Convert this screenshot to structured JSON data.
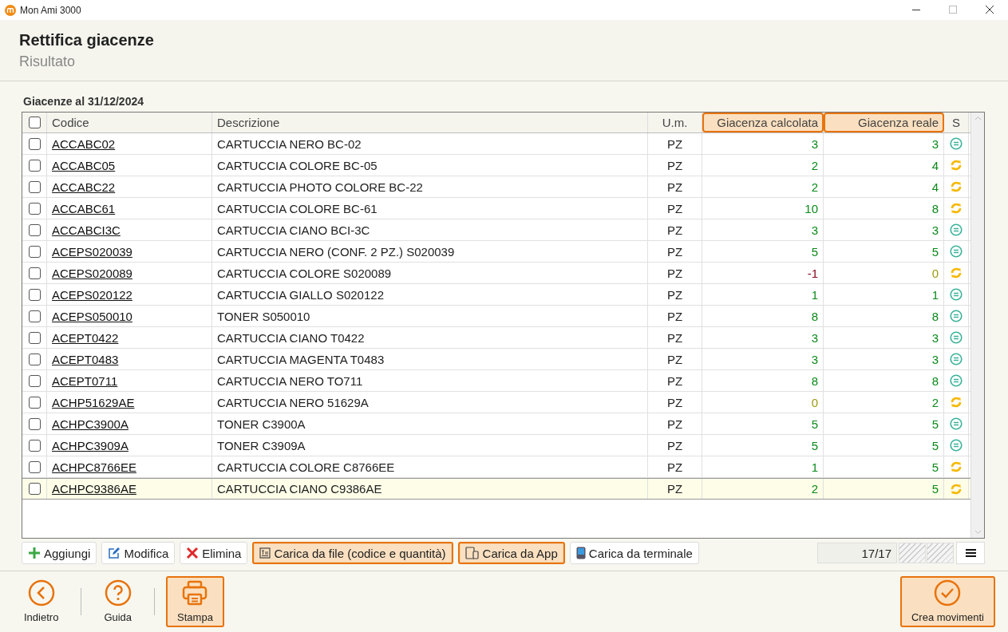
{
  "window": {
    "title": "Mon Ami 3000"
  },
  "header": {
    "title": "Rettifica giacenze",
    "subtitle": "Risultato"
  },
  "section_title": "Giacenze al 31/12/2024",
  "table": {
    "select_all_checked": false,
    "columns": [
      {
        "label": "Codice",
        "highlighted": false
      },
      {
        "label": "Descrizione",
        "highlighted": false
      },
      {
        "label": "U.m.",
        "highlighted": false
      },
      {
        "label": "Giacenza calcolata",
        "highlighted": true
      },
      {
        "label": "Giacenza reale",
        "highlighted": true
      },
      {
        "label": "S",
        "highlighted": false
      }
    ],
    "rows": [
      {
        "code": "ACCABC02",
        "description": "CARTUCCIA NERO BC-02",
        "unit": "PZ",
        "calculated": {
          "text": "3",
          "color": "#0a8a1a"
        },
        "real": {
          "text": "3",
          "color": "#0a8a1a"
        },
        "changed": false,
        "checked": false,
        "selected": false
      },
      {
        "code": "ACCABC05",
        "description": "CARTUCCIA COLORE BC-05",
        "unit": "PZ",
        "calculated": {
          "text": "2",
          "color": "#0a8a1a"
        },
        "real": {
          "text": "4",
          "color": "#0a8a1a"
        },
        "changed": true,
        "checked": false,
        "selected": false
      },
      {
        "code": "ACCABC22",
        "description": "CARTUCCIA PHOTO COLORE BC-22",
        "unit": "PZ",
        "calculated": {
          "text": "2",
          "color": "#0a8a1a"
        },
        "real": {
          "text": "4",
          "color": "#0a8a1a"
        },
        "changed": true,
        "checked": false,
        "selected": false
      },
      {
        "code": "ACCABC61",
        "description": "CARTUCCIA COLORE BC-61",
        "unit": "PZ",
        "calculated": {
          "text": "10",
          "color": "#0a8a1a"
        },
        "real": {
          "text": "8",
          "color": "#0a8a1a"
        },
        "changed": true,
        "checked": false,
        "selected": false
      },
      {
        "code": "ACCABCI3C",
        "description": "CARTUCCIA CIANO BCI-3C",
        "unit": "PZ",
        "calculated": {
          "text": "3",
          "color": "#0a8a1a"
        },
        "real": {
          "text": "3",
          "color": "#0a8a1a"
        },
        "changed": false,
        "checked": false,
        "selected": false
      },
      {
        "code": "ACEPS020039",
        "description": "CARTUCCIA NERO (CONF. 2 PZ.) S020039",
        "unit": "PZ",
        "calculated": {
          "text": "5",
          "color": "#0a8a1a"
        },
        "real": {
          "text": "5",
          "color": "#0a8a1a"
        },
        "changed": false,
        "checked": false,
        "selected": false
      },
      {
        "code": "ACEPS020089",
        "description": "CARTUCCIA COLORE S020089",
        "unit": "PZ",
        "calculated": {
          "text": "-1",
          "color": "#8a0a20"
        },
        "real": {
          "text": "0",
          "color": "#9a9a10"
        },
        "changed": true,
        "checked": false,
        "selected": false
      },
      {
        "code": "ACEPS020122",
        "description": "CARTUCCIA GIALLO S020122",
        "unit": "PZ",
        "calculated": {
          "text": "1",
          "color": "#0a8a1a"
        },
        "real": {
          "text": "1",
          "color": "#0a8a1a"
        },
        "changed": false,
        "checked": false,
        "selected": false
      },
      {
        "code": "ACEPS050010",
        "description": "TONER S050010",
        "unit": "PZ",
        "calculated": {
          "text": "8",
          "color": "#0a8a1a"
        },
        "real": {
          "text": "8",
          "color": "#0a8a1a"
        },
        "changed": false,
        "checked": false,
        "selected": false
      },
      {
        "code": "ACEPT0422",
        "description": "CARTUCCIA CIANO T0422",
        "unit": "PZ",
        "calculated": {
          "text": "3",
          "color": "#0a8a1a"
        },
        "real": {
          "text": "3",
          "color": "#0a8a1a"
        },
        "changed": false,
        "checked": false,
        "selected": false
      },
      {
        "code": "ACEPT0483",
        "description": "CARTUCCIA MAGENTA T0483",
        "unit": "PZ",
        "calculated": {
          "text": "3",
          "color": "#0a8a1a"
        },
        "real": {
          "text": "3",
          "color": "#0a8a1a"
        },
        "changed": false,
        "checked": false,
        "selected": false
      },
      {
        "code": "ACEPT0711",
        "description": "CARTUCCIA NERO TO711",
        "unit": "PZ",
        "calculated": {
          "text": "8",
          "color": "#0a8a1a"
        },
        "real": {
          "text": "8",
          "color": "#0a8a1a"
        },
        "changed": false,
        "checked": false,
        "selected": false
      },
      {
        "code": "ACHP51629AE",
        "description": "CARTUCCIA NERO 51629A",
        "unit": "PZ",
        "calculated": {
          "text": "0",
          "color": "#9a9a10"
        },
        "real": {
          "text": "2",
          "color": "#0a8a1a"
        },
        "changed": true,
        "checked": false,
        "selected": false
      },
      {
        "code": "ACHPC3900A",
        "description": "TONER C3900A",
        "unit": "PZ",
        "calculated": {
          "text": "5",
          "color": "#0a8a1a"
        },
        "real": {
          "text": "5",
          "color": "#0a8a1a"
        },
        "changed": false,
        "checked": false,
        "selected": false
      },
      {
        "code": "ACHPC3909A",
        "description": "TONER C3909A",
        "unit": "PZ",
        "calculated": {
          "text": "5",
          "color": "#0a8a1a"
        },
        "real": {
          "text": "5",
          "color": "#0a8a1a"
        },
        "changed": false,
        "checked": false,
        "selected": false
      },
      {
        "code": "ACHPC8766EE",
        "description": "CARTUCCIA COLORE C8766EE",
        "unit": "PZ",
        "calculated": {
          "text": "1",
          "color": "#0a8a1a"
        },
        "real": {
          "text": "5",
          "color": "#0a8a1a"
        },
        "changed": true,
        "checked": false,
        "selected": false
      },
      {
        "code": "ACHPC9386AE",
        "description": "CARTUCCIA CIANO C9386AE",
        "unit": "PZ",
        "calculated": {
          "text": "2",
          "color": "#0a8a1a"
        },
        "real": {
          "text": "5",
          "color": "#0a8a1a"
        },
        "changed": true,
        "checked": false,
        "selected": true
      }
    ]
  },
  "toolbar": {
    "buttons": [
      {
        "label": "Aggiungi",
        "kind": "add",
        "highlighted": false
      },
      {
        "label": "Modifica",
        "kind": "edit",
        "highlighted": false
      },
      {
        "label": "Elimina",
        "kind": "delete",
        "highlighted": false
      },
      {
        "label": "Carica da file (codice e quantità)",
        "kind": "file",
        "highlighted": true
      },
      {
        "label": "Carica da App",
        "kind": "app",
        "highlighted": true
      },
      {
        "label": "Carica da terminale",
        "kind": "terminal",
        "highlighted": false
      }
    ],
    "count": "17/17"
  },
  "footer": {
    "left": [
      {
        "label": "Indietro",
        "kind": "back",
        "highlighted": false
      },
      {
        "label": "Guida",
        "kind": "help",
        "highlighted": false
      },
      {
        "label": "Stampa",
        "kind": "print",
        "highlighted": true
      }
    ],
    "right": [
      {
        "label": "Crea movimenti",
        "kind": "confirm",
        "highlighted": true
      }
    ]
  }
}
